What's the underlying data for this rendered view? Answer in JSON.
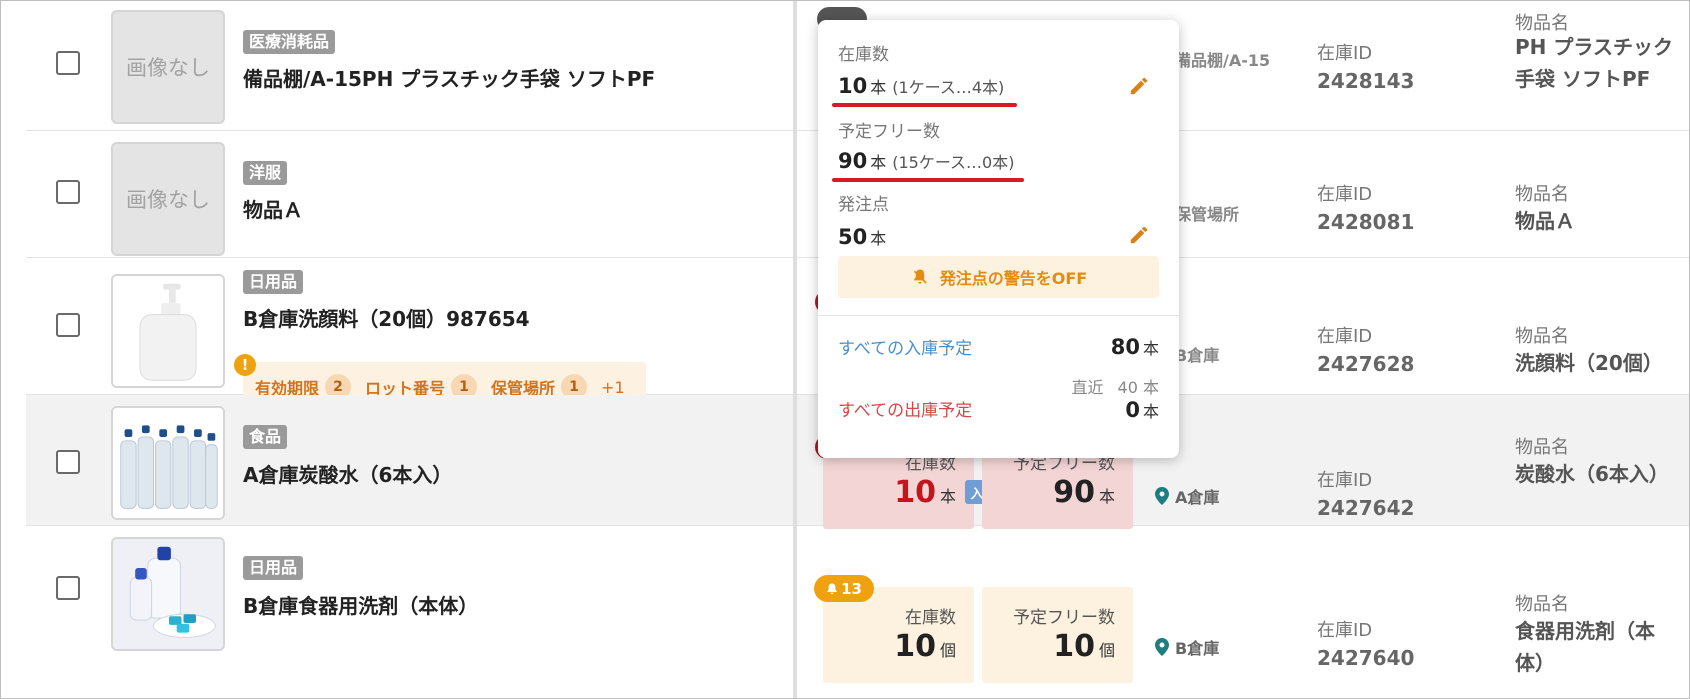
{
  "products": [
    {
      "category": "医療消耗品",
      "name": "備品棚/A-15PH プラスチック手袋 ソフトPF",
      "image": "画像なし",
      "stock_id_label": "在庫ID",
      "stock_id": "2428143",
      "item_name_label": "物品名",
      "item_name": "PH プラスチック手袋 ソフトPF",
      "location": "備品棚/A-15"
    },
    {
      "category": "洋服",
      "name": "物品Ａ",
      "image": "画像なし",
      "stock_id_label": "在庫ID",
      "stock_id": "2428081",
      "item_name_label": "物品名",
      "item_name": "物品Ａ",
      "location": "保管場所"
    },
    {
      "category": "日用品",
      "name": "B倉庫洗顔料（20個）987654",
      "stock_id_label": "在庫ID",
      "stock_id": "2427628",
      "item_name_label": "物品名",
      "item_name": "洗顔料（20個）",
      "location": "B倉庫",
      "warnings": {
        "mark": "!",
        "expiry_label": "有効期限",
        "expiry_count": "2",
        "lot_label": "ロット番号",
        "lot_count": "1",
        "storage_label": "保管場所",
        "storage_count": "1",
        "more": "+1"
      }
    },
    {
      "category": "食品",
      "name": "A倉庫炭酸水（6本入）",
      "stock_id_label": "在庫ID",
      "stock_id": "2427642",
      "item_name_label": "物品名",
      "item_name": "炭酸水（6本入）",
      "location": "A倉庫",
      "stock_label": "在庫数",
      "stock_value": "10",
      "stock_unit": "本",
      "free_label": "予定フリー数",
      "free_value": "90",
      "free_unit": "本",
      "in_badge": "入"
    },
    {
      "category": "日用品",
      "name": "B倉庫食器用洗剤（本体）",
      "stock_id_label": "在庫ID",
      "stock_id": "2427640",
      "item_name_label": "物品名",
      "item_name": "食器用洗剤（本体）",
      "location": "B倉庫",
      "alert_count": "13",
      "stock_label": "在庫数",
      "stock_value": "10",
      "stock_unit": "個",
      "free_label": "予定フリー数",
      "free_value": "10",
      "free_unit": "個"
    }
  ],
  "popup": {
    "stock_label": "在庫数",
    "stock_value": "10",
    "stock_unit": "本",
    "stock_detail": "(1ケース…4本)",
    "free_label": "予定フリー数",
    "free_value": "90",
    "free_unit": "本",
    "free_detail": "(15ケース…0本)",
    "reorder_label": "発注点",
    "reorder_value": "50",
    "reorder_unit": "本",
    "alert_off_label": "発注点の警告をOFF",
    "incoming_link": "すべての入庫予定",
    "incoming_value": "80",
    "incoming_unit": "本",
    "recent_label": "直近",
    "recent_value": "40 本",
    "outgoing_link": "すべての出庫予定",
    "outgoing_value": "0",
    "outgoing_unit": "本"
  },
  "colors": {
    "accent_orange": "#f0a10f",
    "alert_red": "#c4151d",
    "link_blue": "#4a8fcf",
    "link_red": "#d54848",
    "underline_red": "#d71a26"
  }
}
